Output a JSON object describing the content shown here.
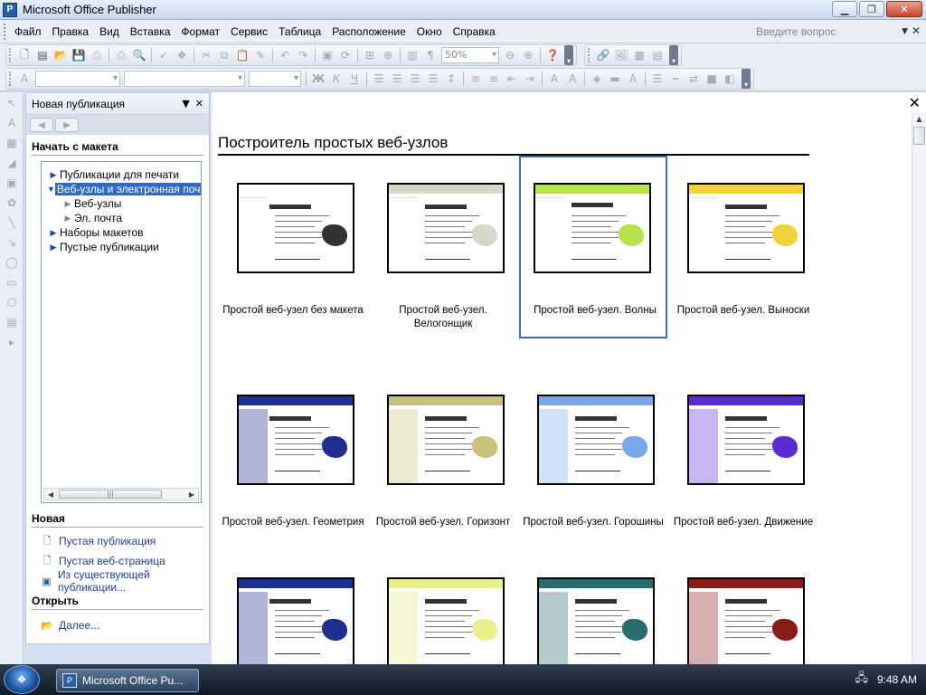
{
  "window": {
    "title": "Microsoft Office Publisher",
    "app_icon_glyph": "P"
  },
  "menu": {
    "items": [
      "Файл",
      "Правка",
      "Вид",
      "Вставка",
      "Формат",
      "Сервис",
      "Таблица",
      "Расположение",
      "Окно",
      "Справка"
    ],
    "ask_placeholder": "Введите вопрос"
  },
  "toolbar": {
    "zoom": "50%"
  },
  "taskpane": {
    "title": "Новая публикация",
    "start_section": "Начать с макета",
    "tree": [
      {
        "label": "Публикации для печати",
        "level": 0,
        "expanded": false,
        "selected": false
      },
      {
        "label": "Веб-узлы и электронная поч",
        "level": 0,
        "expanded": true,
        "selected": true
      },
      {
        "label": "Веб-узлы",
        "level": 1,
        "expanded": false,
        "selected": false
      },
      {
        "label": "Эл. почта",
        "level": 1,
        "expanded": false,
        "selected": false
      },
      {
        "label": "Наборы макетов",
        "level": 0,
        "expanded": false,
        "selected": false
      },
      {
        "label": "Пустые публикации",
        "level": 0,
        "expanded": false,
        "selected": false
      }
    ],
    "new_section": "Новая",
    "new_links": [
      "Пустая публикация",
      "Пустая веб-страница",
      "Из существующей публикации..."
    ],
    "open_section": "Открыть",
    "open_links": [
      "Далее..."
    ]
  },
  "gallery": {
    "title": "Построитель простых веб-узлов",
    "items": [
      {
        "label": "Простой веб-узел без макета",
        "selected": false,
        "accent": "#ffffff"
      },
      {
        "label": "Простой веб-узел. Велогонщик",
        "selected": false,
        "accent": "#d8d8c8"
      },
      {
        "label": "Простой веб-узел. Волны",
        "selected": true,
        "accent": "#b7e34a"
      },
      {
        "label": "Простой веб-узел. Выноски",
        "selected": false,
        "accent": "#f2d23a"
      },
      {
        "label": "Простой веб-узел. Геометрия",
        "selected": false,
        "accent": "#1e2f8f"
      },
      {
        "label": "Простой веб-узел. Горизонт",
        "selected": false,
        "accent": "#c9c27a"
      },
      {
        "label": "Простой веб-узел. Горошины",
        "selected": false,
        "accent": "#7aa8e8"
      },
      {
        "label": "Простой веб-узел. Движение",
        "selected": false,
        "accent": "#5b2bd6"
      },
      {
        "label": "",
        "selected": false,
        "accent": "#1e2f8f"
      },
      {
        "label": "",
        "selected": false,
        "accent": "#e9ef8a"
      },
      {
        "label": "",
        "selected": false,
        "accent": "#2a6b6b"
      },
      {
        "label": "",
        "selected": false,
        "accent": "#8b1a1a"
      }
    ]
  },
  "taskbar": {
    "button_label": "Microsoft Office Pu...",
    "clock": "9:48 AM"
  },
  "colors": {
    "selection": "#316ac5",
    "link": "#1e3f9e",
    "card_border": "#3e6fa8"
  }
}
